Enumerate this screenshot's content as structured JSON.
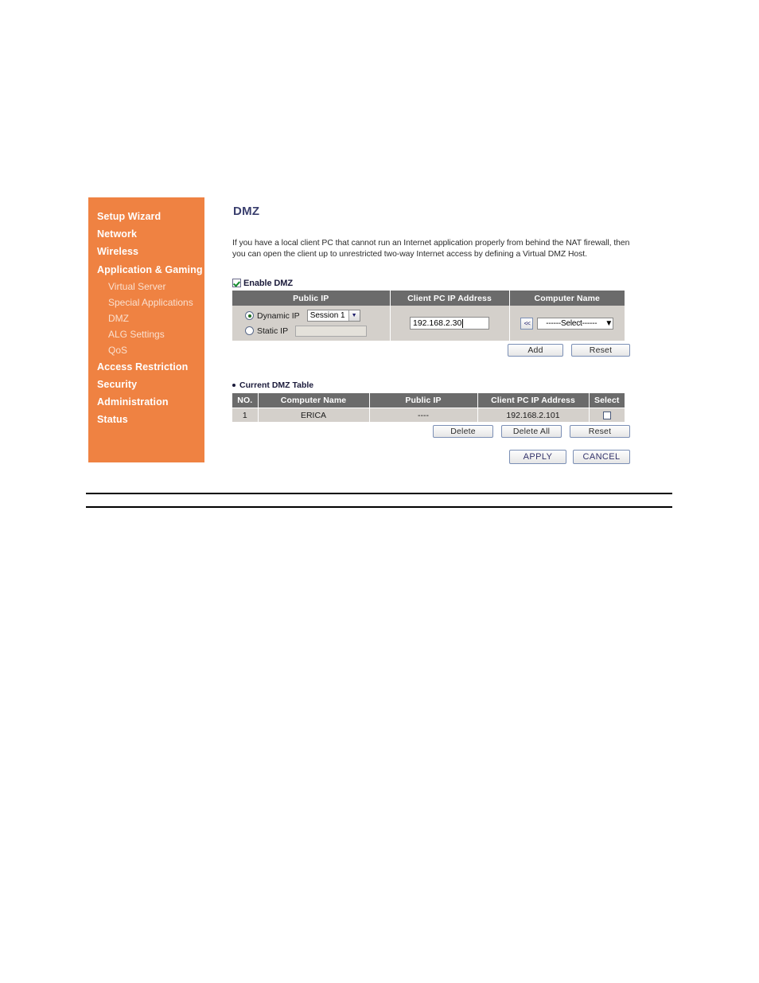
{
  "sidebar": {
    "items": [
      {
        "label": "Setup Wizard",
        "level": "top"
      },
      {
        "label": "Network",
        "level": "top"
      },
      {
        "label": "Wireless",
        "level": "top"
      },
      {
        "label": "Application & Gaming",
        "level": "top"
      },
      {
        "label": "Virtual Server",
        "level": "sub"
      },
      {
        "label": "Special Applications",
        "level": "sub"
      },
      {
        "label": "DMZ",
        "level": "sub"
      },
      {
        "label": "ALG Settings",
        "level": "sub"
      },
      {
        "label": "QoS",
        "level": "sub"
      },
      {
        "label": "Access Restriction",
        "level": "top"
      },
      {
        "label": "Security",
        "level": "top"
      },
      {
        "label": "Administration",
        "level": "top"
      },
      {
        "label": "Status",
        "level": "top"
      }
    ],
    "bg_color": "#ef8242",
    "top_text_color": "#ffffff",
    "sub_text_color": "#fae0cf"
  },
  "main": {
    "title": "DMZ",
    "title_color": "#3a3f6e",
    "description": "If you have a local client PC that cannot run an Internet application properly from behind the NAT firewall, then you can open the client up to unrestricted two-way Internet access by defining a Virtual DMZ Host.",
    "enable": {
      "label": "Enable DMZ",
      "checked": true,
      "check_color": "#128a2c"
    },
    "form": {
      "headers": [
        "Public IP",
        "Client PC IP Address",
        "Computer Name"
      ],
      "header_bg": "#6b6b6b",
      "row_bg": "#d4d0cb",
      "public_ip": {
        "dynamic_label": "Dynamic IP",
        "dynamic_selected": true,
        "session_value": "Session 1",
        "static_label": "Static IP",
        "static_selected": false,
        "static_value": ""
      },
      "client_pc_ip_value": "192.168.2.30",
      "computer_name": {
        "copy_button_label": "<<",
        "select_value": "------Select------"
      },
      "buttons": [
        {
          "label": "Add"
        },
        {
          "label": "Reset"
        }
      ]
    },
    "current_table": {
      "caption": "Current DMZ Table",
      "headers": [
        "NO.",
        "Computer Name",
        "Public IP",
        "Client PC IP Address",
        "Select"
      ],
      "rows": [
        {
          "no": "1",
          "computer_name": "ERICA",
          "public_ip": "----",
          "client_pc_ip": "192.168.2.101",
          "selected": false
        }
      ],
      "buttons": [
        {
          "label": "Delete"
        },
        {
          "label": "Delete All"
        },
        {
          "label": "Reset"
        }
      ]
    },
    "footer_buttons": [
      {
        "label": "APPLY"
      },
      {
        "label": "CANCEL"
      }
    ]
  }
}
